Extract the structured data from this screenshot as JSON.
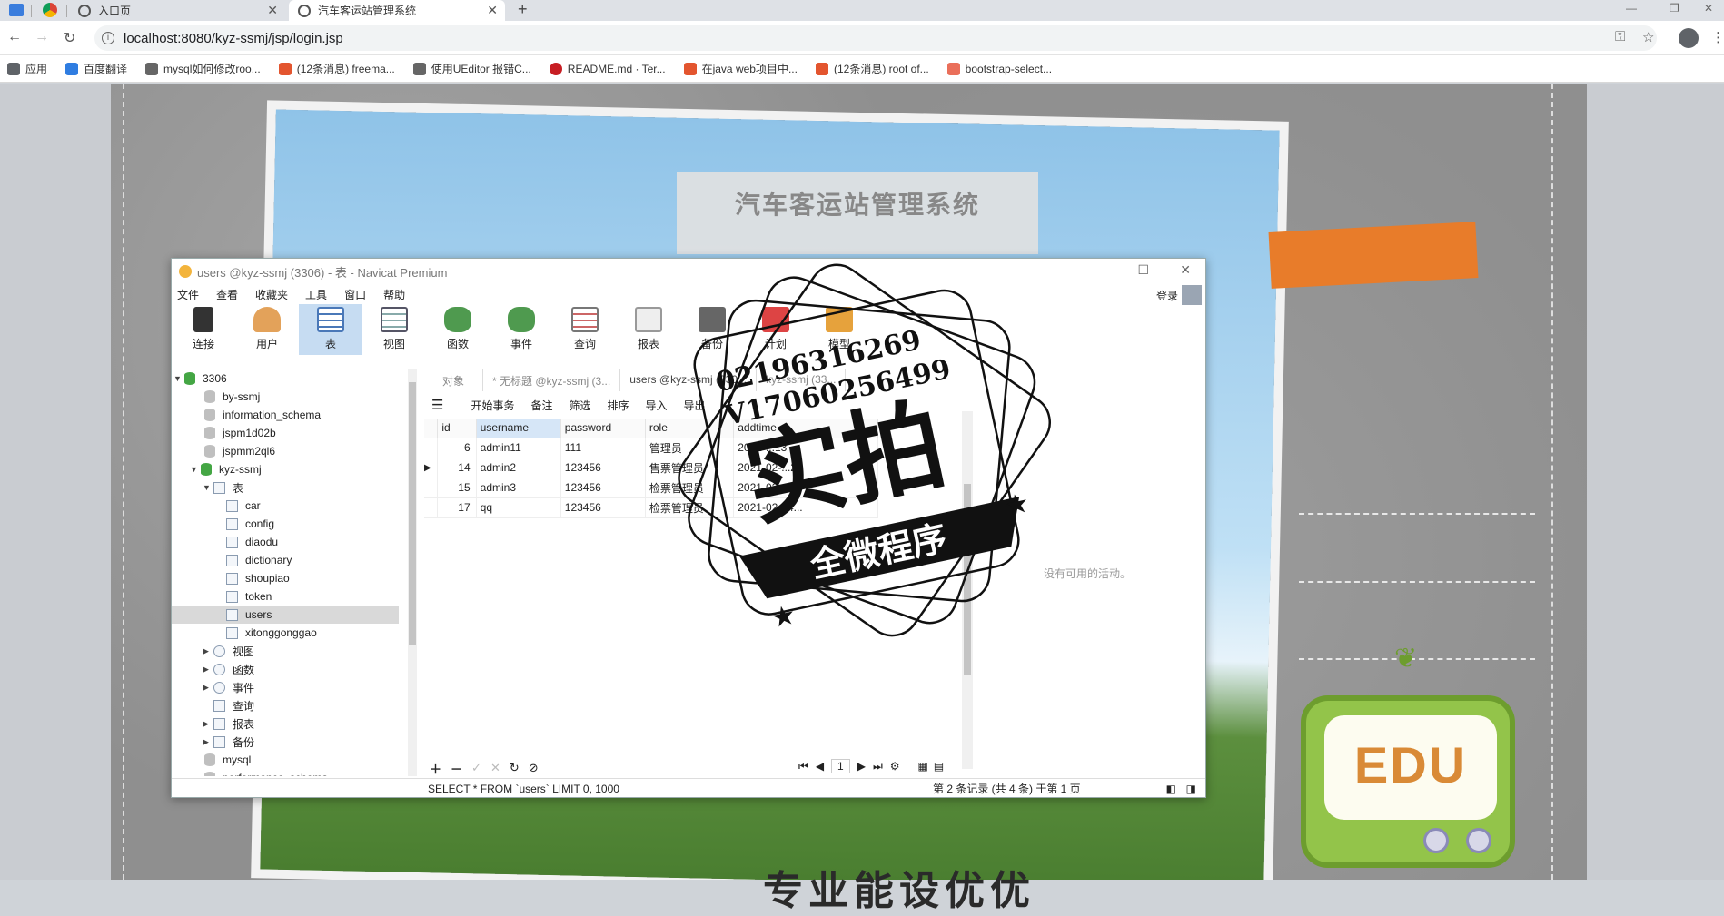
{
  "browser": {
    "tabs": [
      {
        "label": "入口页",
        "active": false
      },
      {
        "label": "汽车客运站管理系统",
        "active": true
      }
    ],
    "url": "localhost:8080/kyz-ssmj/jsp/login.jsp",
    "bookmarks": [
      {
        "label": "应用",
        "icon": "apps-icon",
        "color": "#5f6368"
      },
      {
        "label": "百度翻译",
        "icon": "translate-icon",
        "color": "#2f7de1"
      },
      {
        "label": "mysql如何修改roo...",
        "icon": "dolphin-icon",
        "color": "#666666"
      },
      {
        "label": "(12条消息) freema...",
        "icon": "csdn-icon",
        "color": "#e3552f"
      },
      {
        "label": "使用UEditor 报错C...",
        "icon": "dolphin-icon",
        "color": "#666666"
      },
      {
        "label": "README.md · Ter...",
        "icon": "gitee-icon",
        "color": "#c71d23"
      },
      {
        "label": "在java web项目中...",
        "icon": "csdn-icon",
        "color": "#e3552f"
      },
      {
        "label": "(12条消息) root of...",
        "icon": "csdn-icon",
        "color": "#e3552f"
      },
      {
        "label": "bootstrap-select...",
        "icon": "jianshu-icon",
        "color": "#ea6f5a"
      }
    ]
  },
  "page": {
    "login_title": "汽车客运站管理系统",
    "edu_label": "EDU",
    "bottom_text": "专业能设优优"
  },
  "navicat": {
    "title": "users @kyz-ssmj (3306) - 表 - Navicat Premium",
    "menu": [
      "文件",
      "查看",
      "收藏夹",
      "工具",
      "窗口",
      "帮助"
    ],
    "login_label": "登录",
    "tools": [
      {
        "label": "连接",
        "active": false
      },
      {
        "label": "用户",
        "active": false
      },
      {
        "label": "表",
        "active": true
      },
      {
        "label": "视图",
        "active": false
      },
      {
        "label": "函数",
        "active": false
      },
      {
        "label": "事件",
        "active": false
      },
      {
        "label": "查询",
        "active": false
      },
      {
        "label": "报表",
        "active": false
      },
      {
        "label": "备份",
        "active": false
      },
      {
        "label": "计划",
        "active": false
      },
      {
        "label": "模型",
        "active": false
      }
    ],
    "tree": [
      {
        "label": "3306",
        "kind": "conn",
        "caret": "v"
      },
      {
        "label": "by-ssmj",
        "kind": "db"
      },
      {
        "label": "information_schema",
        "kind": "db"
      },
      {
        "label": "jspm1d02b",
        "kind": "db"
      },
      {
        "label": "jspmm2ql6",
        "kind": "db"
      },
      {
        "label": "kyz-ssmj",
        "kind": "dbopen",
        "caret": "v"
      },
      {
        "label": "表",
        "kind": "folder",
        "caret": "v"
      },
      {
        "label": "car",
        "kind": "table"
      },
      {
        "label": "config",
        "kind": "table"
      },
      {
        "label": "diaodu",
        "kind": "table"
      },
      {
        "label": "dictionary",
        "kind": "table"
      },
      {
        "label": "shoupiao",
        "kind": "table"
      },
      {
        "label": "token",
        "kind": "table"
      },
      {
        "label": "users",
        "kind": "table",
        "selected": true
      },
      {
        "label": "xitonggonggao",
        "kind": "table"
      },
      {
        "label": "视图",
        "kind": "folder",
        "caret": ">"
      },
      {
        "label": "函数",
        "kind": "folder",
        "caret": ">"
      },
      {
        "label": "事件",
        "kind": "folder",
        "caret": ">"
      },
      {
        "label": "查询",
        "kind": "folder"
      },
      {
        "label": "报表",
        "kind": "folder",
        "caret": ">"
      },
      {
        "label": "备份",
        "kind": "folder",
        "caret": ">"
      },
      {
        "label": "mysql",
        "kind": "db"
      },
      {
        "label": "performance_schema",
        "kind": "db"
      }
    ],
    "object_tabs": [
      {
        "label": "对象",
        "active": false
      },
      {
        "label": "* 无标题 @kyz-ssmj (3...",
        "active": false
      },
      {
        "label": "users @kyz-ssmj (330...",
        "active": true
      },
      {
        "label": "kyz-ssmj (33...",
        "active": false
      }
    ],
    "actions": [
      "开始事务",
      "备注",
      "筛选",
      "排序",
      "导入",
      "导出"
    ],
    "columns": [
      "id",
      "username",
      "password",
      "role",
      "addtime"
    ],
    "rows": [
      [
        "6",
        "admin11",
        "111",
        "管理员",
        "2021-...13"
      ],
      [
        "14",
        "admin2",
        "123456",
        "售票管理员",
        "2021-02-...21"
      ],
      [
        "15",
        "admin3",
        "123456",
        "检票管理员",
        "2021-02-..."
      ],
      [
        "17",
        "qq",
        "123456",
        "检票管理员",
        "2021-02-24..."
      ]
    ],
    "side_message": "没有可用的活动。",
    "page_number": "1",
    "sql": "SELECT * FROM `users` LIMIT 0, 1000",
    "record_status": "第 2 条记录 (共 4 条) 于第 1 页"
  },
  "watermark": {
    "phone": "02196316269",
    "code": "V17060256499",
    "big_text": "实拍",
    "ribbon_text": "全微程序"
  }
}
